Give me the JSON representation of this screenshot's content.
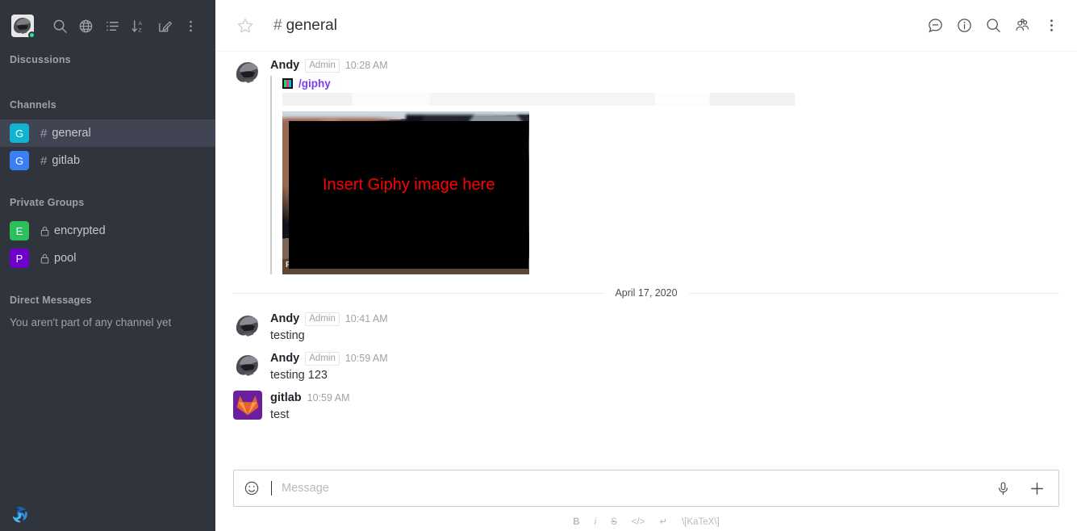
{
  "colors": {
    "sidebar_bg": "#2f343d",
    "sidebar_active": "#414453",
    "accent_purple": "#7a3ff2",
    "status_online": "#2de0a5",
    "overlay_text": "#ff0000"
  },
  "sidebar": {
    "topbar": {
      "avatar_name": "user-avatar-helmet",
      "status": "online",
      "icons": [
        {
          "name": "search-icon",
          "label": "Search"
        },
        {
          "name": "globe-icon",
          "label": "Directory"
        },
        {
          "name": "list-icon",
          "label": "Sort"
        },
        {
          "name": "sort-az-icon",
          "label": "Sort A-Z"
        },
        {
          "name": "create-new-icon",
          "label": "Create new"
        },
        {
          "name": "kebab-menu-icon",
          "label": "Options"
        }
      ]
    },
    "sections": [
      {
        "title": "Discussions",
        "items": []
      },
      {
        "title": "Channels",
        "items": [
          {
            "badge": "G",
            "badge_color": "#11b3cf",
            "prefix": "hash",
            "name": "general",
            "active": true
          },
          {
            "badge": "G",
            "badge_color": "#3a7ff5",
            "prefix": "hash",
            "name": "gitlab",
            "active": false
          }
        ]
      },
      {
        "title": "Private Groups",
        "items": [
          {
            "badge": "E",
            "badge_color": "#2dbf5c",
            "prefix": "lock",
            "name": "encrypted",
            "active": false
          },
          {
            "badge": "P",
            "badge_color": "#6d00cc",
            "prefix": "lock",
            "name": "pool",
            "active": false
          }
        ]
      },
      {
        "title": "Direct Messages",
        "empty_text": "You aren't part of any channel yet",
        "items": []
      }
    ],
    "logo_name": "rocketchat-logo"
  },
  "header": {
    "favorite_icon": "star-icon",
    "channel_prefix": "#",
    "channel_name": "general",
    "actions": [
      {
        "name": "threads-icon",
        "label": "Threads"
      },
      {
        "name": "info-icon",
        "label": "Channel info"
      },
      {
        "name": "search-icon",
        "label": "Search messages"
      },
      {
        "name": "members-icon",
        "label": "Members"
      },
      {
        "name": "kebab-menu-icon",
        "label": "Options"
      }
    ]
  },
  "messages": [
    {
      "id": "m1",
      "avatar": "user-avatar-helmet",
      "user": "Andy",
      "role": "Admin",
      "time": "10:28 AM",
      "type": "giphy",
      "giphy": {
        "icon": "giphy-icon",
        "command": "/giphy",
        "separator": ":",
        "overlay_text": "Insert Giphy image here",
        "watermark": "FY"
      }
    },
    {
      "id": "m2",
      "avatar": "user-avatar-helmet",
      "user": "Andy",
      "role": "Admin",
      "time": "10:41 AM",
      "type": "text",
      "text": "testing"
    },
    {
      "id": "m3",
      "avatar": "user-avatar-helmet",
      "user": "Andy",
      "role": "Admin",
      "time": "10:59 AM",
      "type": "text",
      "text": "testing 123"
    },
    {
      "id": "m4",
      "avatar": "gitlab-avatar",
      "user": "gitlab",
      "role": "",
      "time": "10:59 AM",
      "type": "text",
      "text": "test"
    }
  ],
  "date_divider": {
    "label": "April 17, 2020"
  },
  "composer": {
    "emoji_icon": "emoji-icon",
    "placeholder": "Message",
    "value": "",
    "audio_icon": "microphone-icon",
    "plus_icon": "plus-icon",
    "formatting": [
      {
        "name": "bold-button",
        "label": "B"
      },
      {
        "name": "italic-button",
        "label": "i"
      },
      {
        "name": "strike-button",
        "label": "S"
      },
      {
        "name": "code-button",
        "label": "</>"
      },
      {
        "name": "multiline-button",
        "label": "↵"
      },
      {
        "name": "katex-button",
        "label": "\\[KaTeX\\]"
      }
    ]
  }
}
